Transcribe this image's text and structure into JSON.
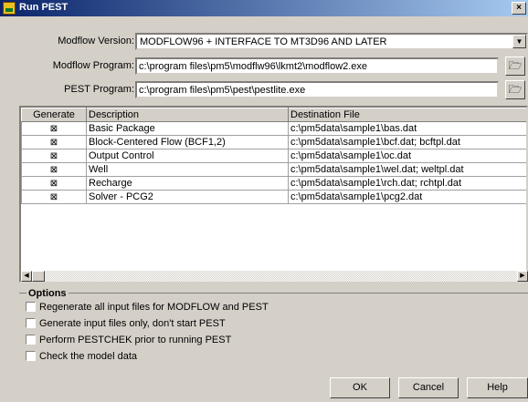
{
  "window": {
    "title": "Run PEST",
    "close_label": "×"
  },
  "modflow_version": {
    "label": "Modflow Version:",
    "value": "MODFLOW96 + INTERFACE TO MT3D96 AND LATER"
  },
  "modflow_program": {
    "label": "Modflow Program:",
    "value": "c:\\program files\\pm5\\modflw96\\lkmt2\\modflow2.exe"
  },
  "pest_program": {
    "label": "PEST Program:",
    "value": "c:\\program files\\pm5\\pest\\pestlite.exe"
  },
  "grid": {
    "headers": [
      "Generate",
      "Description",
      "Destination File"
    ],
    "rows": [
      {
        "checked": true,
        "description": "Basic Package",
        "file": "c:\\pm5data\\sample1\\bas.dat"
      },
      {
        "checked": true,
        "description": "Block-Centered Flow (BCF1,2)",
        "file": "c:\\pm5data\\sample1\\bcf.dat; bcftpl.dat"
      },
      {
        "checked": true,
        "description": "Output Control",
        "file": "c:\\pm5data\\sample1\\oc.dat"
      },
      {
        "checked": true,
        "description": "Well",
        "file": "c:\\pm5data\\sample1\\wel.dat; weltpl.dat"
      },
      {
        "checked": true,
        "description": "Recharge",
        "file": "c:\\pm5data\\sample1\\rch.dat; rchtpl.dat"
      },
      {
        "checked": true,
        "description": "Solver - PCG2",
        "file": "c:\\pm5data\\sample1\\pcg2.dat"
      }
    ]
  },
  "options": {
    "legend": "Options",
    "items": [
      {
        "label": "Regenerate all input files for MODFLOW and PEST",
        "checked": false
      },
      {
        "label": "Generate input files only, don't start PEST",
        "checked": false
      },
      {
        "label": "Perform PESTCHEK prior to running PEST",
        "checked": false
      },
      {
        "label": "Check the model data",
        "checked": false
      }
    ]
  },
  "buttons": {
    "ok": "OK",
    "cancel": "Cancel",
    "help": "Help"
  }
}
